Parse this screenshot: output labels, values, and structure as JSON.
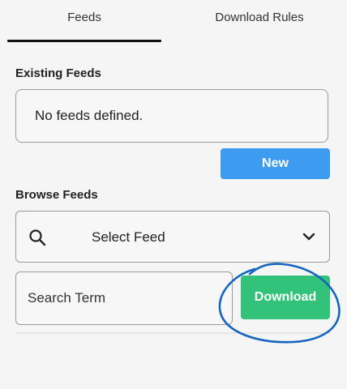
{
  "tabs": [
    {
      "label": "Feeds",
      "active": true
    },
    {
      "label": "Download Rules",
      "active": false
    }
  ],
  "existing_feeds": {
    "heading": "Existing Feeds",
    "empty_text": "No feeds defined.",
    "new_button": "New"
  },
  "browse_feeds": {
    "heading": "Browse Feeds",
    "select_value": "Select Feed",
    "search_icon": "search-icon",
    "chevron_icon": "chevron-down-icon",
    "search_placeholder": "Search Term",
    "download_button": "Download"
  },
  "colors": {
    "new_button": "#3d9cf0",
    "download_button": "#33c27a",
    "annotation": "#1565c0"
  }
}
